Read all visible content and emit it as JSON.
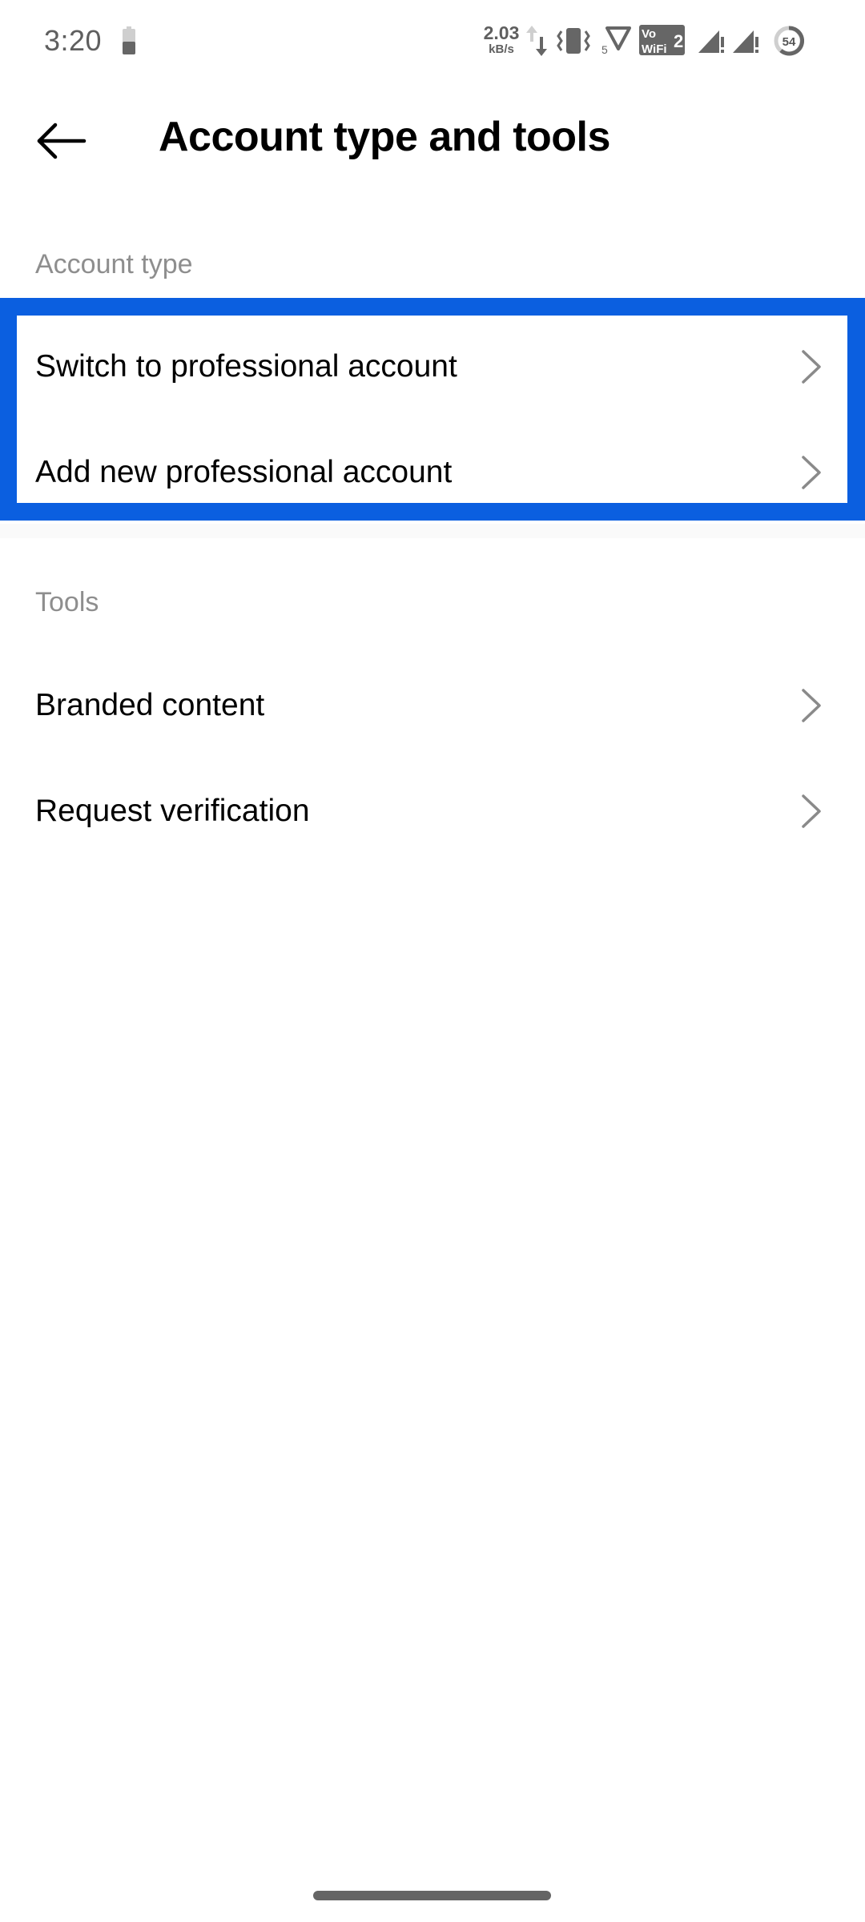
{
  "status_bar": {
    "time": "3:20",
    "battery_small_icon": "battery-icon",
    "net_speed_value": "2.03",
    "net_speed_unit": "kB/s",
    "icons": [
      "data-transfer-arrows-icon",
      "vibrate-icon",
      "vpn-5-icon",
      "vowifi-2-icon",
      "signal-no-service-icon",
      "signal-no-service-icon",
      "battery-circle-icon"
    ],
    "vowifi_label_top": "Vo",
    "vowifi_label_bottom": "WiFi",
    "vowifi_sim": "2",
    "vpn_number": "5",
    "battery_percent": "54"
  },
  "header": {
    "back_icon": "arrow-left-icon",
    "title": "Account type and tools"
  },
  "sections": [
    {
      "header": "Account type",
      "items": [
        {
          "label": "Switch to professional account",
          "icon": "chevron-right-icon"
        },
        {
          "label": "Add new professional account",
          "icon": "chevron-right-icon"
        }
      ]
    },
    {
      "header": "Tools",
      "items": [
        {
          "label": "Branded content",
          "icon": "chevron-right-icon"
        },
        {
          "label": "Request verification",
          "icon": "chevron-right-icon"
        }
      ]
    }
  ],
  "colors": {
    "highlight": "#0B5FE0",
    "section_header": "#8E8E8E",
    "chevron": "#8A8A8A",
    "separator": "#FAFAFA"
  }
}
